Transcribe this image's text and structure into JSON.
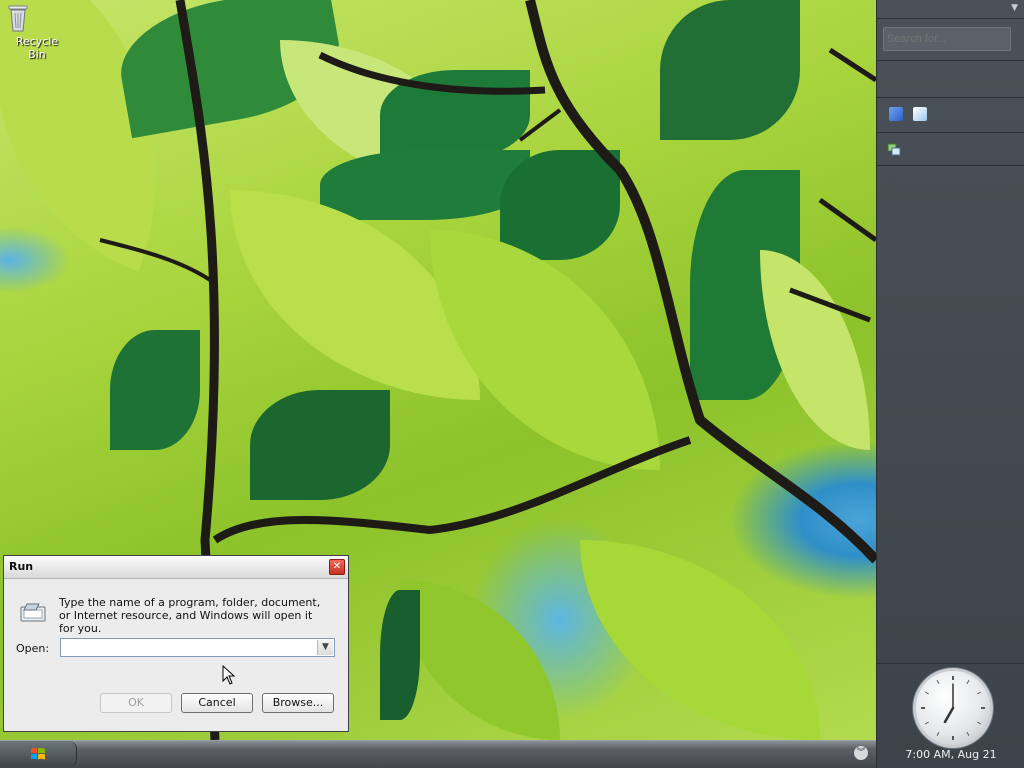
{
  "desktop": {
    "icons": [
      {
        "label": "Recycle Bin",
        "icon": "recycle-bin-icon"
      }
    ]
  },
  "sidebar": {
    "search_placeholder": "Search for...",
    "clock_time": "7:00 AM, Aug 21",
    "clock": {
      "hour": 7,
      "minute": 0
    }
  },
  "run_dialog": {
    "title": "Run",
    "description": "Type the name of a program, folder, document, or Internet resource, and Windows will open it for you.",
    "open_label": "Open:",
    "open_value": "",
    "ok_label": "OK",
    "cancel_label": "Cancel",
    "browse_label": "Browse..."
  },
  "taskbar": {
    "start_icon": "windows-logo-icon"
  }
}
